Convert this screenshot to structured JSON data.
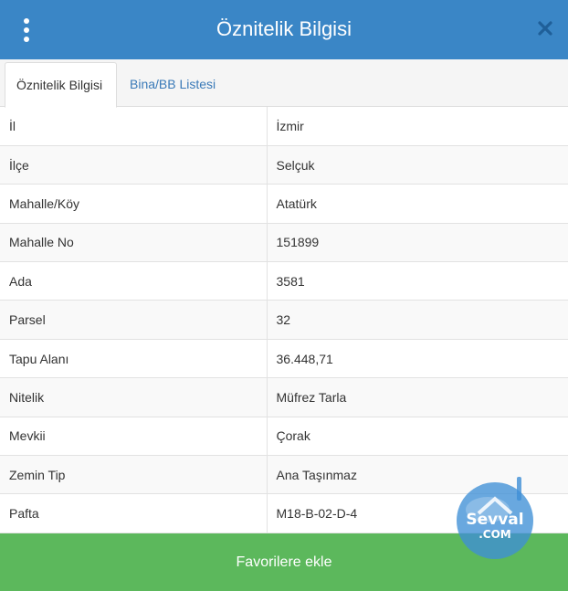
{
  "header": {
    "title": "Öznitelik Bilgisi",
    "menu_icon": "vertical-ellipsis-icon",
    "close_icon": "close-icon",
    "color": "#3a86c6"
  },
  "tabs": [
    {
      "label": "Öznitelik Bilgisi",
      "active": true
    },
    {
      "label": "Bina/BB Listesi",
      "active": false
    }
  ],
  "attributes": [
    {
      "key": "İl",
      "value": "İzmir"
    },
    {
      "key": "İlçe",
      "value": "Selçuk"
    },
    {
      "key": "Mahalle/Köy",
      "value": "Atatürk"
    },
    {
      "key": "Mahalle No",
      "value": "151899"
    },
    {
      "key": "Ada",
      "value": "3581"
    },
    {
      "key": "Parsel",
      "value": "32"
    },
    {
      "key": "Tapu Alanı",
      "value": "36.448,71"
    },
    {
      "key": "Nitelik",
      "value": "Müfrez Tarla"
    },
    {
      "key": "Mevkii",
      "value": "Çorak"
    },
    {
      "key": "Zemin Tip",
      "value": "Ana Taşınmaz"
    },
    {
      "key": "Pafta",
      "value": "M18-B-02-D-4"
    }
  ],
  "footer": {
    "button_label": "Favorilere ekle",
    "color": "#5cb85c"
  },
  "watermark": {
    "text": "Sevval",
    "sub": ".COM"
  }
}
